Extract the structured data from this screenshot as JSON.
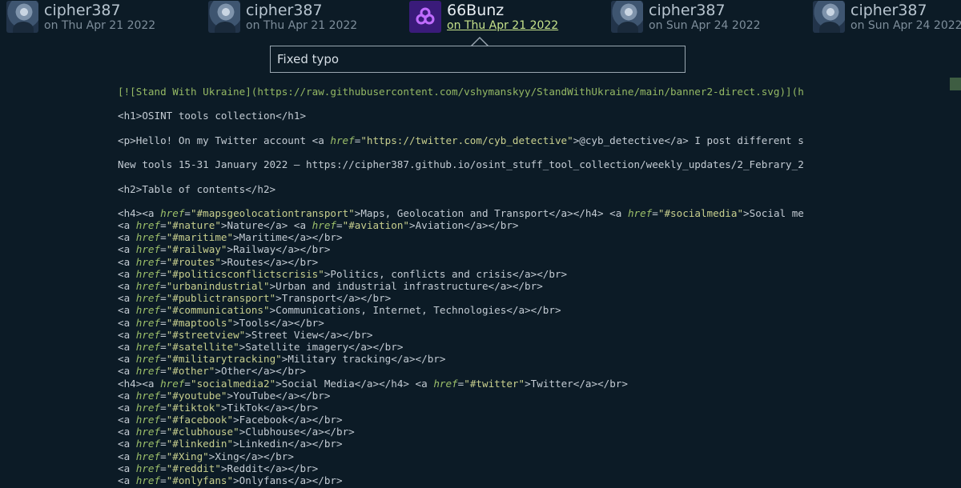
{
  "commits": [
    {
      "author": "cipher387",
      "date": "on Thu Apr 21 2022",
      "avatar": "person-avatar"
    },
    {
      "author": "cipher387",
      "date": "on Thu Apr 21 2022",
      "avatar": "person-avatar"
    },
    {
      "author": "66Bunz",
      "date": "on Thu Apr 21 2022",
      "avatar": "org-logo"
    },
    {
      "author": "cipher387",
      "date": "on Sun Apr 24 2022",
      "avatar": "person-avatar"
    },
    {
      "author": "cipher387",
      "date": "on Sun Apr 24 2022",
      "avatar": "person-avatar"
    }
  ],
  "tooltip": {
    "message": "Fixed typo"
  },
  "code": {
    "banner": "[![Stand With Ukraine](https://raw.githubusercontent.com/vshymanskyy/StandWithUkraine/main/banner2-direct.svg)](h",
    "h1": "<h1>OSINT tools collection</h1>",
    "p_open": "<p>Hello! On my Twitter account <a ",
    "p_href": "\"https://twitter.com/cyb_detective\"",
    "p_rest": ">@cyb_detective</a> I post different s",
    "new_tools": "New tools 15-31 January 2022 — https://cipher387.github.io/osint_stuff_tool_collection/weekly_updates/2_Febrary_2",
    "h2": "<h2>Table of contents</h2>",
    "h4_first": {
      "pre": "<h4><a ",
      "href1": "\"#mapsgeolocationtransport\"",
      "mid": ">Maps, Geolocation and Transport</a></h4> <a ",
      "href2": "\"#socialmedia\"",
      "post": ">Social me"
    },
    "nature_line": {
      "pre": "<a ",
      "href1": "\"#nature\"",
      "mid": ">Nature</a> <a ",
      "href2": "\"#aviation\"",
      "post": ">Aviation</a></br>"
    },
    "links1": [
      {
        "href": "\"#maritime\"",
        "text": ">Maritime</a></br>"
      },
      {
        "href": "\"#railway\"",
        "text": ">Railway</a></br>"
      },
      {
        "href": "\"#routes\"",
        "text": ">Routes</a></br>"
      },
      {
        "href": "\"#politicsconflictscrisis\"",
        "text": ">Politics, conflicts and crisis</a></br>"
      },
      {
        "href": "\"urbanindustrial\"",
        "text": ">Urban and industrial infrastructure</a></br>"
      },
      {
        "href": "\"#publictransport\"",
        "text": ">Transport</a></br>"
      },
      {
        "href": "\"#communications\"",
        "text": ">Communications, Internet, Technologies</a></br>"
      },
      {
        "href": "\"#maptools\"",
        "text": ">Tools</a></br>"
      },
      {
        "href": "\"#streetview\"",
        "text": ">Street View</a></br>"
      },
      {
        "href": "\"#satellite\"",
        "text": ">Satellite imagery</a></br>"
      },
      {
        "href": "\"#militarytracking\"",
        "text": ">Military tracking</a></br>"
      },
      {
        "href": "\"#other\"",
        "text": ">Other</a></br>"
      }
    ],
    "h4_social": {
      "pre": "<h4><a ",
      "href1": "\"socialmedia2\"",
      "mid": ">Social Media</a></h4> <a ",
      "href2": "\"#twitter\"",
      "post": ">Twitter</a></br>"
    },
    "links2": [
      {
        "href": "\"#youtube\"",
        "text": ">YouTube</a></br>"
      },
      {
        "href": "\"#tiktok\"",
        "text": ">TikTok</a></br>"
      },
      {
        "href": "\"#facebook\"",
        "text": ">Facebook</a></br>"
      },
      {
        "href": "\"#clubhouse\"",
        "text": ">Clubhouse</a></br>"
      },
      {
        "href": "\"#linkedin\"",
        "text": ">Linkedin</a></br>"
      },
      {
        "href": "\"#Xing\"",
        "text": ">Xing</a></br>"
      },
      {
        "href": "\"#reddit\"",
        "text": ">Reddit</a></br>"
      },
      {
        "href": "\"#onlyfans\"",
        "text": ">Onlyfans</a></br>"
      }
    ],
    "a_open": "<a ",
    "href_attr": "href",
    "eq": "="
  },
  "colors": {
    "background": "#0c1b26",
    "accent_date": "#c6e38b",
    "attribute": "#9dc06a",
    "markdown": "#95b964"
  }
}
